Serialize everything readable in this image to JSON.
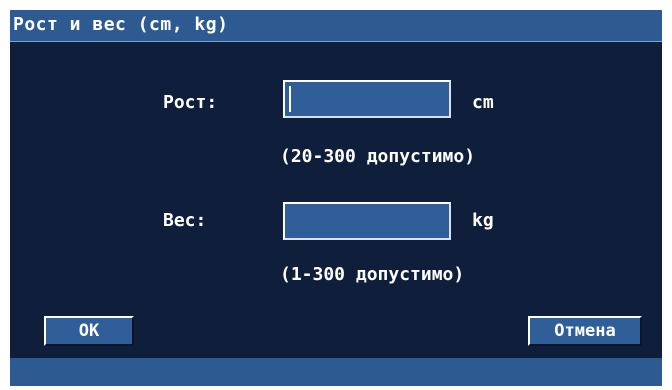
{
  "dialog": {
    "title": "Рост и вес (cm, kg)"
  },
  "height": {
    "label": "Рост:",
    "value": "",
    "unit": "cm",
    "hint": "(20-300 допустимо)"
  },
  "weight": {
    "label": "Вес:",
    "value": "",
    "unit": "kg",
    "hint": "(1-300 допустимо)"
  },
  "buttons": {
    "ok_label": "OK",
    "cancel_label": "Отмена"
  },
  "colors": {
    "background": "#0f1f3b",
    "titlebar": "#2e5a92",
    "field": "#2f5e98",
    "text": "#ffffff"
  }
}
